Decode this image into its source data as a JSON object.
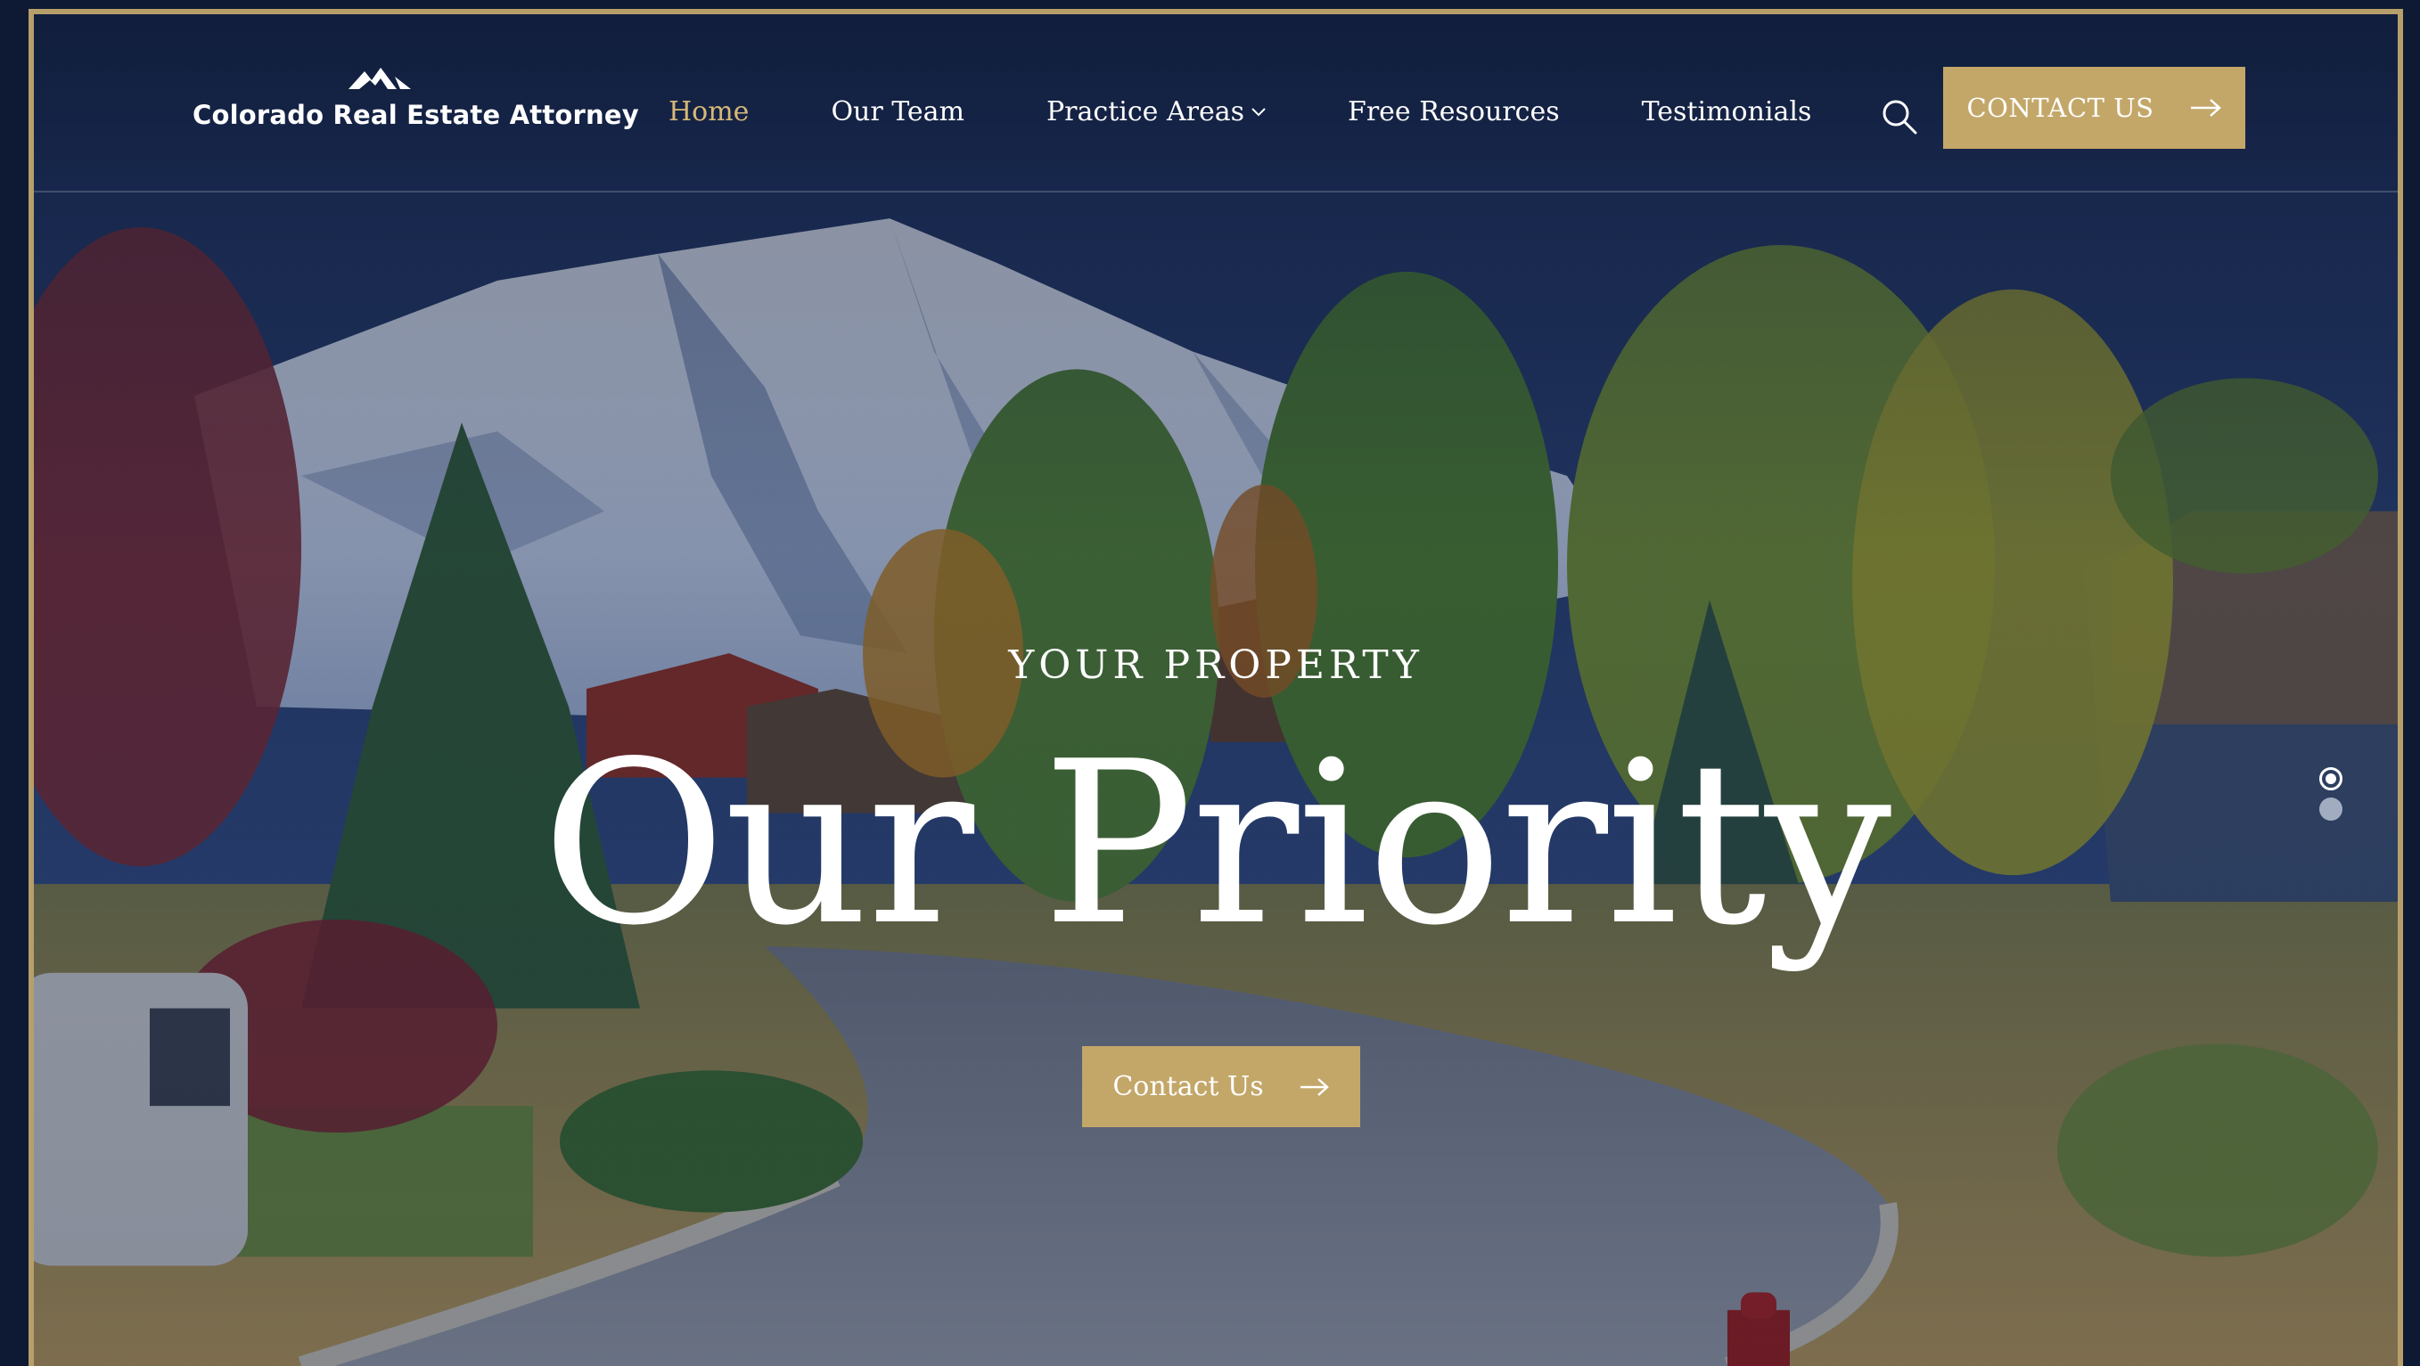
{
  "brand": {
    "name": "Colorado Real Estate Attorney",
    "accent_color": "#c3a769",
    "active_nav_color": "#d8b877",
    "navy": "#0e1a33"
  },
  "nav": {
    "items": [
      {
        "label": "Home",
        "active": true
      },
      {
        "label": "Our Team",
        "active": false
      },
      {
        "label": "Practice Areas",
        "active": false,
        "has_dropdown": true
      },
      {
        "label": "Free Resources",
        "active": false
      },
      {
        "label": "Testimonials",
        "active": false
      }
    ],
    "search_icon": "search-icon",
    "cta_label": "CONTACT US",
    "cta_icon": "arrow-right-icon"
  },
  "hero": {
    "eyebrow": "YOUR PROPERTY",
    "headline": "Our Priority",
    "button_label": "Contact Us",
    "button_icon": "arrow-right-icon",
    "background": "Mountain neighborhood photo",
    "slides": {
      "count": 2,
      "active_index": 0
    }
  }
}
